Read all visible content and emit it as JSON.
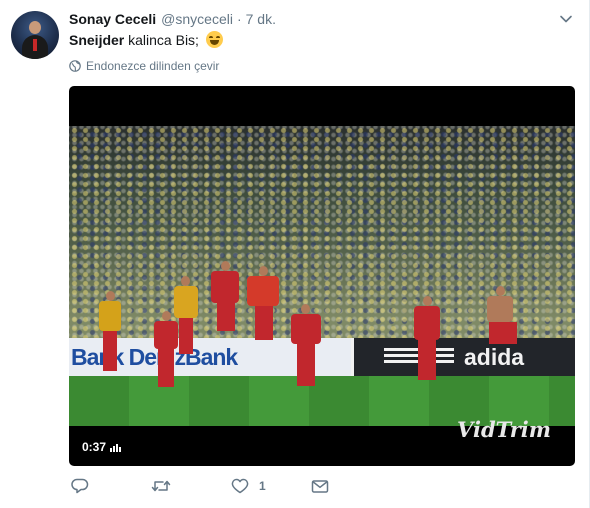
{
  "author": {
    "name": "Sonay Ceceli",
    "handle": "@snyceceli",
    "separator": "·",
    "time": "7 dk."
  },
  "tweet": {
    "bold_text": "Sneijder",
    "text": " kalinca Bis;",
    "emoji": "grinning-face-emoji"
  },
  "translate": {
    "label": "Endonezce dilinden çevir",
    "icon": "globe-icon"
  },
  "video": {
    "duration": "0:37",
    "watermark": "VidTrim",
    "board_text_left": "Bank  DenizBank",
    "board_text_right": "adida"
  },
  "actions": {
    "reply_icon": "reply-icon",
    "retweet_icon": "retweet-icon",
    "like_icon": "heart-icon",
    "like_count": "1",
    "dm_icon": "envelope-icon"
  },
  "colors": {
    "secondary_text": "#657786",
    "primary_text": "#14171a",
    "border": "#e6ecf0"
  }
}
